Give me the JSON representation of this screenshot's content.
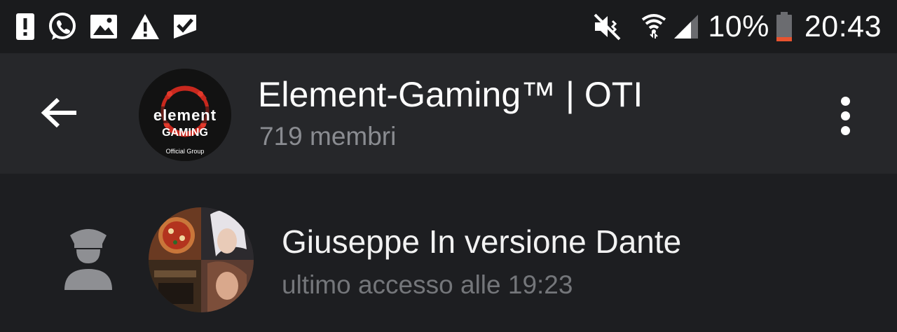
{
  "status_bar": {
    "left_icons": [
      "alert-icon",
      "whatsapp-icon",
      "gallery-icon",
      "warning-icon",
      "check-notification-icon"
    ],
    "right_icons": [
      "mute-vibrate-icon",
      "wifi-icon",
      "signal-icon",
      "battery-icon"
    ],
    "battery": "10%",
    "time": "20:43",
    "battery_color": "#e8532f"
  },
  "toolbar": {
    "title": "Element-Gaming™ | OTI",
    "subtitle": "719 membri",
    "avatar": {
      "brand": "element",
      "sub": "GAMING",
      "tag": "Official Group"
    }
  },
  "member": {
    "name": "Giuseppe In versione Dante",
    "status": "ultimo accesso alle 19:23",
    "role_icon": "admin-officer-icon"
  },
  "colors": {
    "status_bg": "#1a1b1d",
    "toolbar_bg": "#26272a",
    "content_bg": "#1d1e21",
    "accent_red": "#c8281e"
  }
}
